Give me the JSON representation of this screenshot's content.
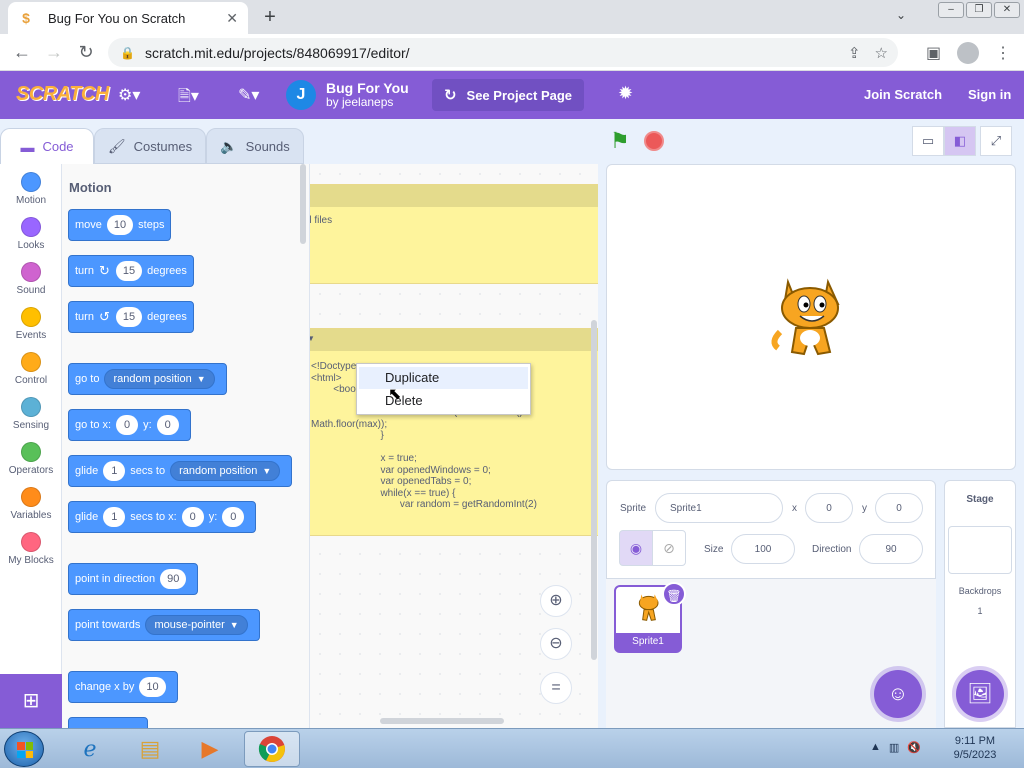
{
  "browser": {
    "tab_title": "Bug For You on Scratch",
    "tab_favicon": "scratch-favicon",
    "url": "scratch.mit.edu/projects/848069917/editor/"
  },
  "scratch_menu": {
    "logo": "SCRATCH",
    "avatar_letter": "J",
    "project_title": "Bug For You",
    "project_by": "by jeelaneps",
    "see_project": "See Project Page",
    "join": "Join Scratch",
    "sign_in": "Sign in"
  },
  "editor_tabs": [
    "Code",
    "Costumes",
    "Sounds"
  ],
  "categories": [
    {
      "label": "Motion",
      "color": "#4c97ff"
    },
    {
      "label": "Looks",
      "color": "#9966ff"
    },
    {
      "label": "Sound",
      "color": "#cf63cf"
    },
    {
      "label": "Events",
      "color": "#ffbf00"
    },
    {
      "label": "Control",
      "color": "#ffab19"
    },
    {
      "label": "Sensing",
      "color": "#5cb1d6"
    },
    {
      "label": "Operators",
      "color": "#59c059"
    },
    {
      "label": "Variables",
      "color": "#ff8c1a"
    },
    {
      "label": "My Blocks",
      "color": "#ff6680"
    }
  ],
  "palette": {
    "title": "Motion",
    "move": {
      "a": "move",
      "n": "10",
      "b": "steps"
    },
    "turn_r": {
      "a": "turn",
      "n": "15",
      "b": "degrees"
    },
    "turn_l": {
      "a": "turn",
      "n": "15",
      "b": "degrees"
    },
    "goto": {
      "a": "go to",
      "d": "random position"
    },
    "gotoxy": {
      "a": "go to x:",
      "x": "0",
      "y_lbl": "y:",
      "y": "0"
    },
    "glide1": {
      "a": "glide",
      "n": "1",
      "b": "secs to",
      "d": "random position"
    },
    "glide2": {
      "a": "glide",
      "n": "1",
      "b": "secs to x:",
      "x": "0",
      "y_lbl": "y:",
      "y": "0"
    },
    "point_dir": {
      "a": "point in direction",
      "n": "90"
    },
    "point_towards": {
      "a": "point towards",
      "d": "mouse-pointer"
    },
    "change_x": {
      "a": "change x by",
      "n": "10"
    }
  },
  "comments": {
    "top_text": "ml files",
    "code_text": "<!Doctype\n<html>\n        <boo\n\n                         return Math.floor(Math.random() *\nMath.floor(max));\n                         }\n\n                         x = true;\n                         var openedWindows = 0;\n                         var openedTabs = 0;\n                         while(x == true) {\n                                var random = getRandomInt(2)"
  },
  "context_menu": [
    "Duplicate",
    "Delete"
  ],
  "sprite_info": {
    "sprite_label": "Sprite",
    "sprite_name": "Sprite1",
    "x_label": "x",
    "x": "0",
    "y_label": "y",
    "y": "0",
    "size_label": "Size",
    "size": "100",
    "direction_label": "Direction",
    "direction": "90"
  },
  "sprite_thumb": "Sprite1",
  "stage_panel": {
    "title": "Stage",
    "backdrops_label": "Backdrops",
    "backdrops_count": "1"
  },
  "taskbar": {
    "time": "9:11 PM",
    "date": "9/5/2023"
  }
}
